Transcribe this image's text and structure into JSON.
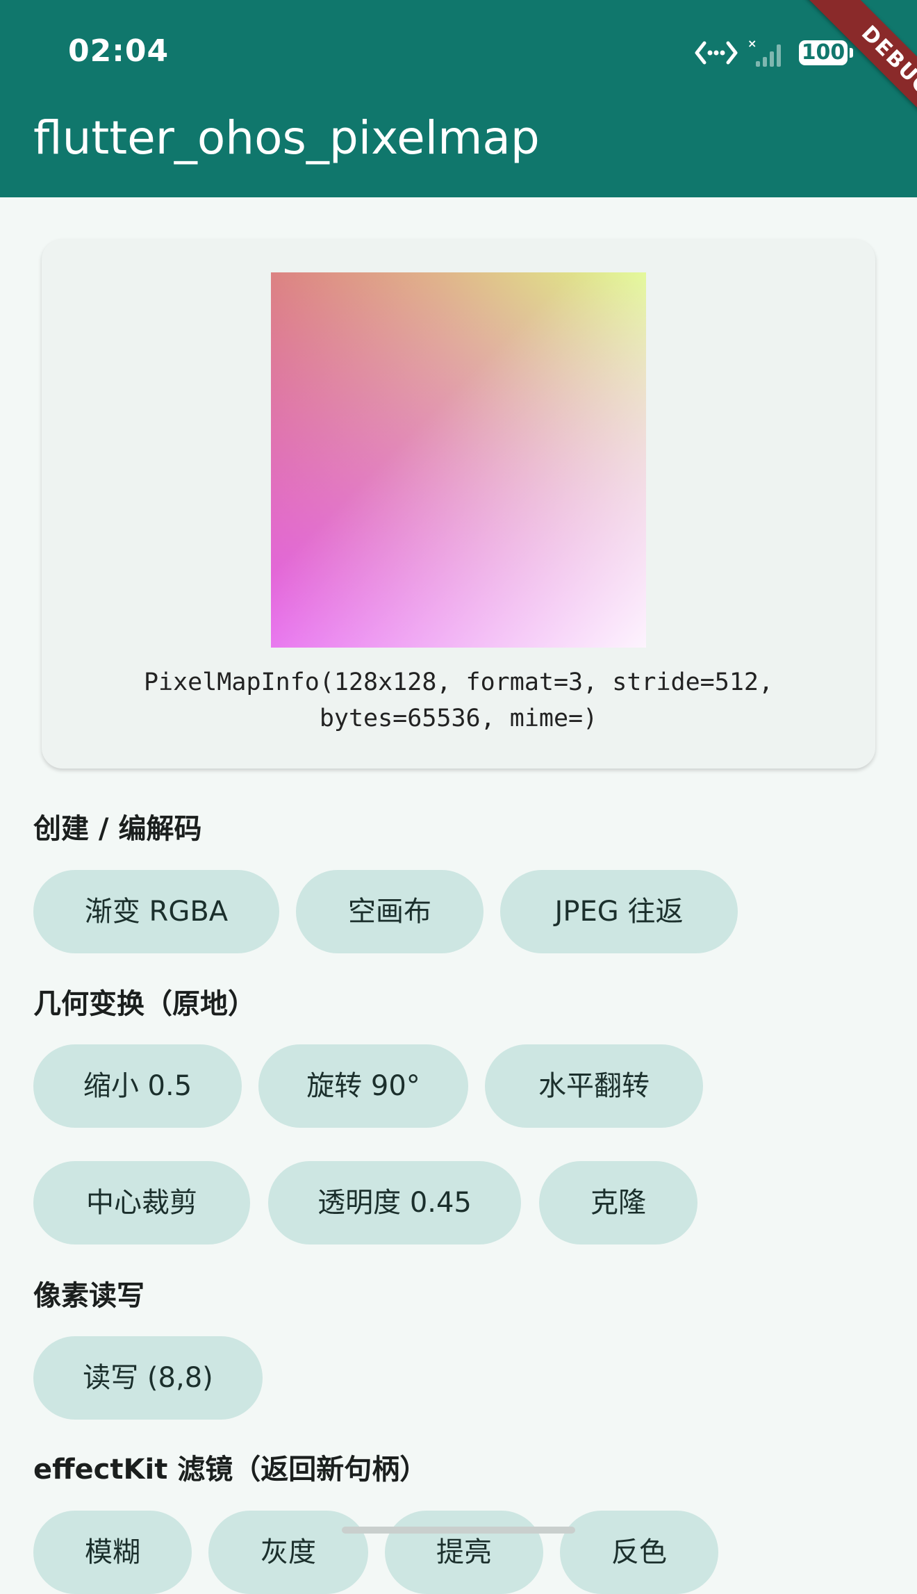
{
  "status_bar": {
    "time": "02:04",
    "battery": "100"
  },
  "debug_banner": "DEBUG",
  "app_bar": {
    "title": "flutter_ohos_pixelmap"
  },
  "preview_card": {
    "info_line1": "PixelMapInfo(128x128, format=3, stride=512,",
    "info_line2": "bytes=65536, mime=)"
  },
  "sections": {
    "create": {
      "title": "创建 / 编解码",
      "buttons": [
        "渐变 RGBA",
        "空画布",
        "JPEG 往返"
      ]
    },
    "transform": {
      "title": "几何变换（原地）",
      "buttons": [
        "缩小 0.5",
        "旋转 90°",
        "水平翻转",
        "中心裁剪",
        "透明度 0.45",
        "克隆"
      ]
    },
    "pixels": {
      "title": "像素读写",
      "buttons": [
        "读写 (8,8)"
      ]
    },
    "effect": {
      "title": "effectKit 滤镜（返回新句柄）",
      "buttons": [
        "模糊",
        "灰度",
        "提亮",
        "反色"
      ]
    }
  },
  "colors": {
    "app_bar": "#10776c",
    "background": "#f3f8f6",
    "chip": "#cde6e2",
    "debug_ribbon": "#8a2a2a"
  },
  "icons": [
    "data-transfer-icon",
    "no-signal-icon",
    "battery-icon"
  ]
}
